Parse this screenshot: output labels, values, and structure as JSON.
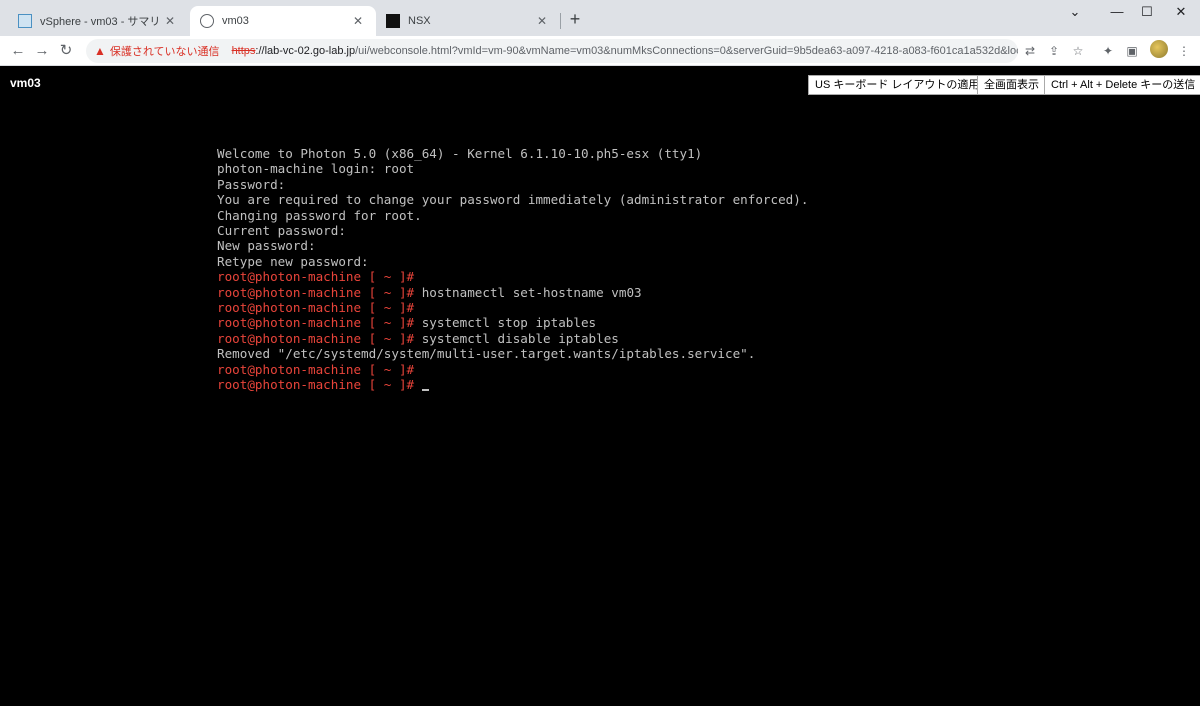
{
  "browser": {
    "tabs": [
      {
        "title": "vSphere - vm03 - サマリ",
        "active": false
      },
      {
        "title": "vm03",
        "active": true
      },
      {
        "title": "NSX",
        "active": false
      }
    ],
    "new_tab": "+",
    "security_warning": "保護されていない通信",
    "url_scheme": "https",
    "url_host": "://lab-vc-02.go-lab.jp",
    "url_path": "/ui/webconsole.html?vmId=vm-90&vmName=vm03&numMksConnections=0&serverGuid=9b5dea63-a097-4218-a083-f601ca1a532d&loc...",
    "warning_color": "#d93025"
  },
  "console": {
    "vm_name": "vm03",
    "buttons": {
      "us_keyboard": "US キーボード レイアウトの適用",
      "fullscreen": "全画面表示",
      "cad": "Ctrl + Alt + Delete キーの送信"
    },
    "lines": [
      {
        "prompt": "",
        "text": "Welcome to Photon 5.0 (x86_64) - Kernel 6.1.10-10.ph5-esx (tty1)"
      },
      {
        "prompt": "",
        "text": "photon-machine login: root"
      },
      {
        "prompt": "",
        "text": "Password:"
      },
      {
        "prompt": "",
        "text": "You are required to change your password immediately (administrator enforced)."
      },
      {
        "prompt": "",
        "text": "Changing password for root."
      },
      {
        "prompt": "",
        "text": "Current password:"
      },
      {
        "prompt": "",
        "text": "New password:"
      },
      {
        "prompt": "",
        "text": "Retype new password:"
      },
      {
        "prompt": "root@photon-machine [ ~ ]#",
        "text": ""
      },
      {
        "prompt": "root@photon-machine [ ~ ]#",
        "text": " hostnamectl set-hostname vm03"
      },
      {
        "prompt": "root@photon-machine [ ~ ]#",
        "text": ""
      },
      {
        "prompt": "root@photon-machine [ ~ ]#",
        "text": " systemctl stop iptables"
      },
      {
        "prompt": "root@photon-machine [ ~ ]#",
        "text": " systemctl disable iptables"
      },
      {
        "prompt": "",
        "text": "Removed \"/etc/systemd/system/multi-user.target.wants/iptables.service\"."
      },
      {
        "prompt": "root@photon-machine [ ~ ]#",
        "text": ""
      },
      {
        "prompt": "root@photon-machine [ ~ ]#",
        "text": " "
      }
    ],
    "prompt_color": "#e8443a",
    "text_color": "#c0c0c0"
  }
}
